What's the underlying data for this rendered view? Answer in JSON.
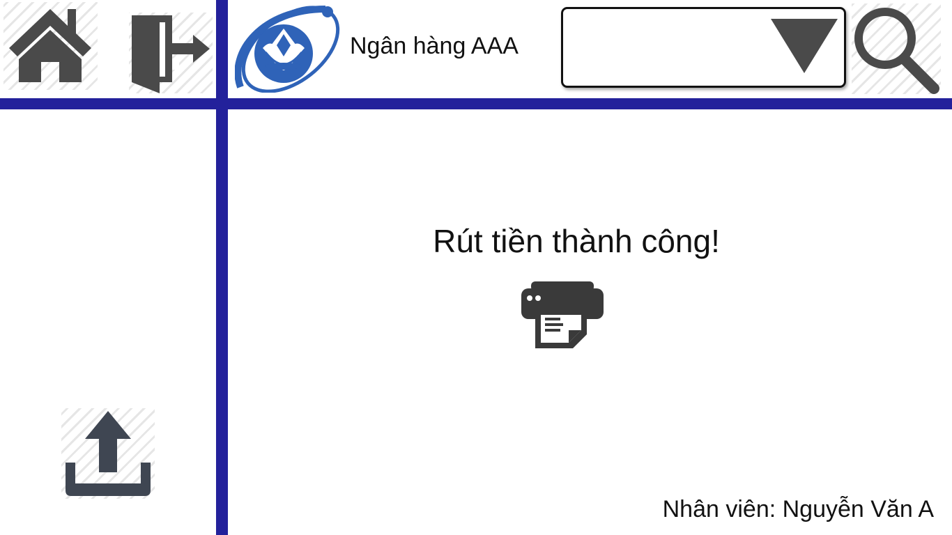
{
  "header": {
    "bank_name": "Ngân hàng AAA",
    "dropdown": {
      "selected_value": "",
      "arrow_icon": "triangle-down-icon"
    },
    "icons": {
      "home": "home-icon",
      "logout": "exit-door-icon",
      "logo": "bank-logo",
      "search": "search-icon"
    }
  },
  "main": {
    "status_message": "Rút tiền thành công!",
    "print_icon": "printer-receipt-icon"
  },
  "sidebar": {
    "upload_icon": "upload-icon"
  },
  "footer": {
    "employee_label": "Nhân viên: Nguyễn Văn A"
  },
  "colors": {
    "divider": "#23219b",
    "icon_gray": "#4a4a4a",
    "logo_blue": "#2f63b8",
    "hatch": "#e6e6e6"
  }
}
